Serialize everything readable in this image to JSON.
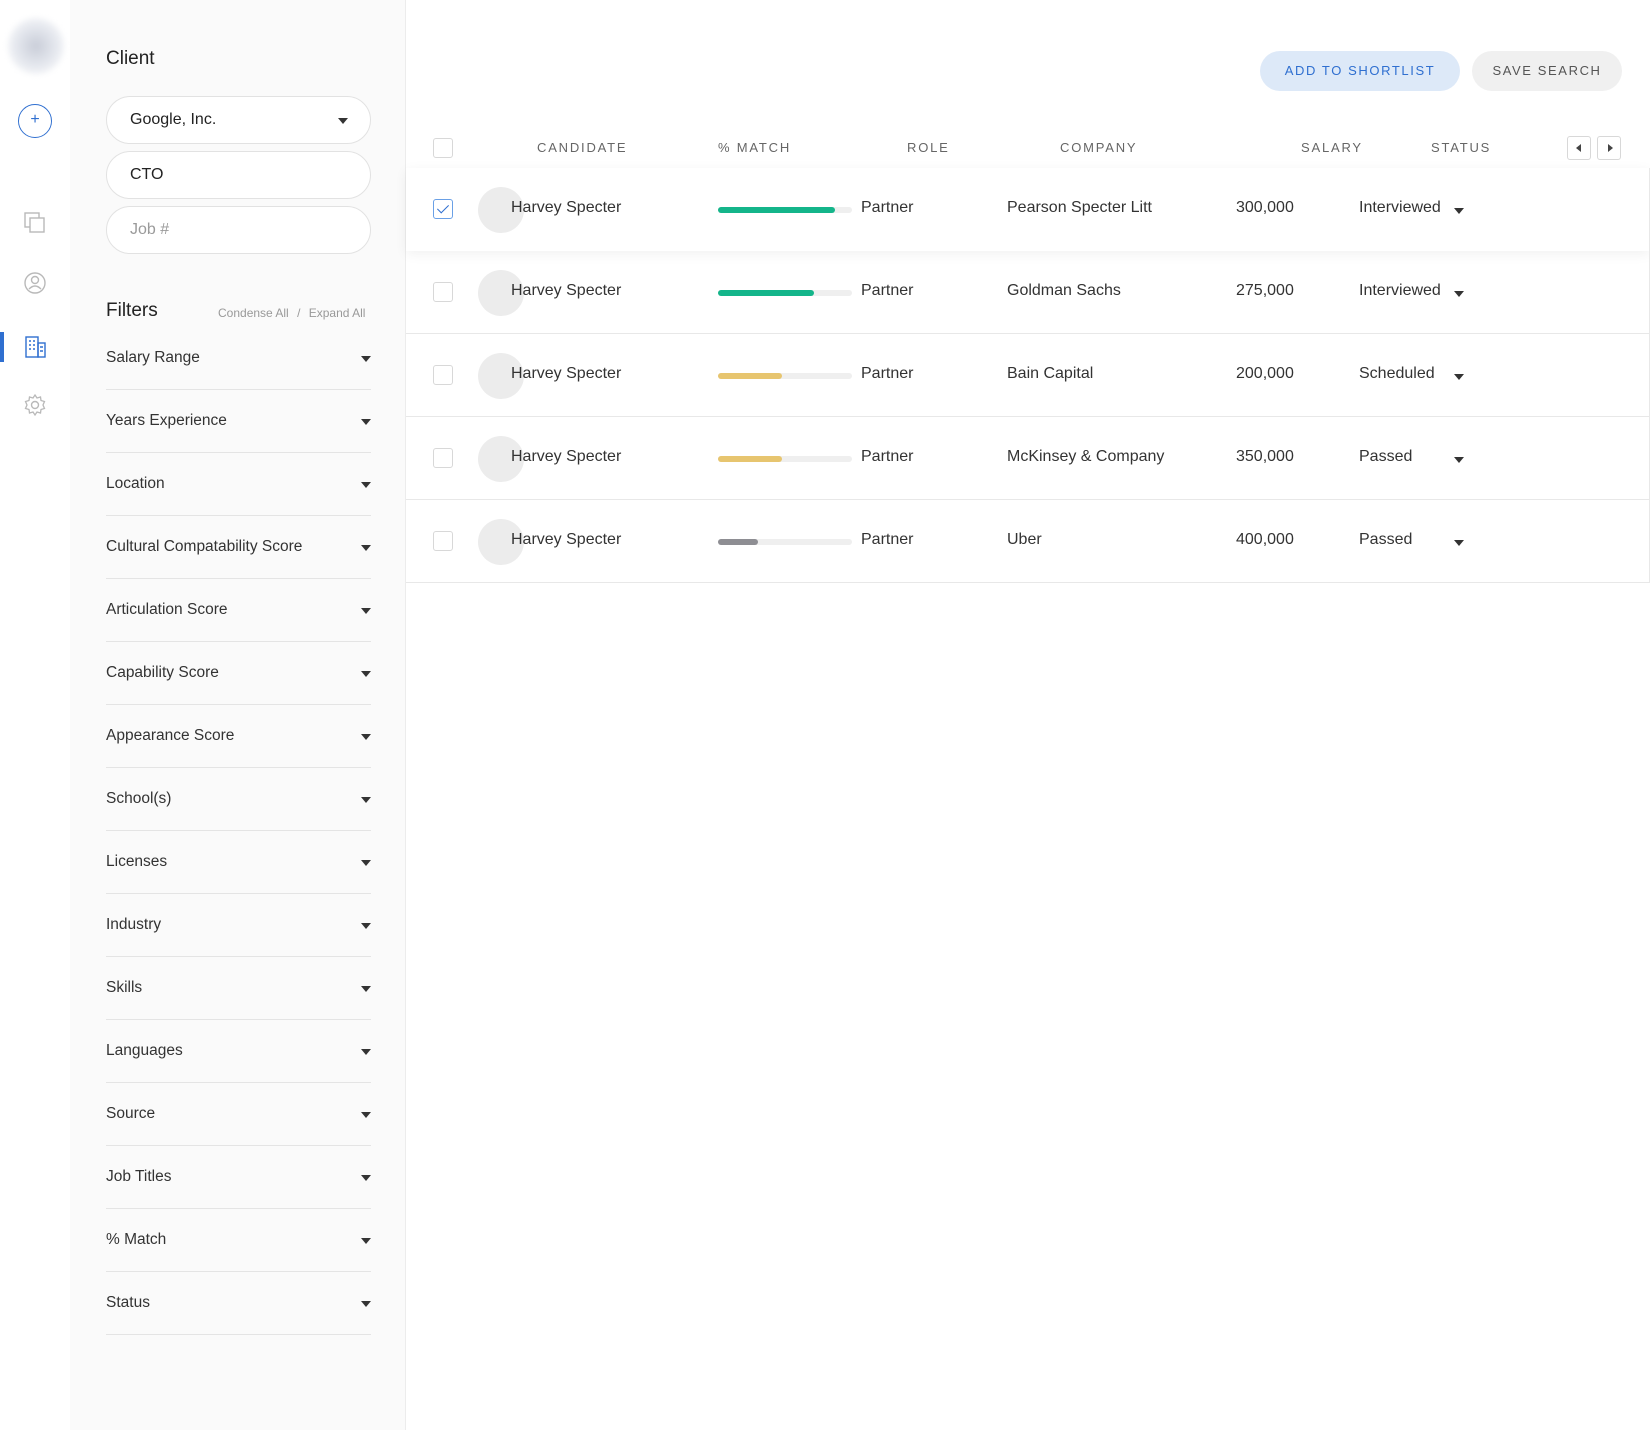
{
  "rail": {
    "add_label": "+",
    "icons": [
      "copy-icon",
      "user-circle-icon",
      "building-icon",
      "gear-icon"
    ],
    "active_color": "#2f6fd0"
  },
  "client": {
    "heading": "Client",
    "client_value": "Google, Inc.",
    "role_value": "CTO",
    "job_placeholder": "Job #"
  },
  "filters": {
    "heading": "Filters",
    "condense_label": "Condense All",
    "separator": "/",
    "expand_label": "Expand All",
    "items": [
      "Salary Range",
      "Years Experience",
      "Location",
      "Cultural Compatability Score",
      "Articulation Score",
      "Capability Score",
      "Appearance Score",
      "School(s)",
      "Licenses",
      "Industry",
      "Skills",
      "Languages",
      "Source",
      "Job Titles",
      "% Match",
      "Status"
    ]
  },
  "actions": {
    "shortlist_label": "ADD TO SHORTLIST",
    "save_label": "SAVE SEARCH"
  },
  "table": {
    "headers": {
      "candidate": "CANDIDATE",
      "match": "% MATCH",
      "role": "ROLE",
      "company": "COMPANY",
      "salary": "SALARY",
      "status": "STATUS"
    },
    "rows": [
      {
        "checked": true,
        "name": "Harvey Specter",
        "match": 0.87,
        "match_color": "#14b58a",
        "role": "Partner",
        "company": "Pearson Specter Litt",
        "salary": "300,000",
        "status": "Interviewed"
      },
      {
        "checked": false,
        "name": "Harvey Specter",
        "match": 0.72,
        "match_color": "#14b58a",
        "role": "Partner",
        "company": "Goldman Sachs",
        "salary": "275,000",
        "status": "Interviewed"
      },
      {
        "checked": false,
        "name": "Harvey Specter",
        "match": 0.48,
        "match_color": "#e7c56f",
        "role": "Partner",
        "company": "Bain Capital",
        "salary": "200,000",
        "status": "Scheduled"
      },
      {
        "checked": false,
        "name": "Harvey Specter",
        "match": 0.48,
        "match_color": "#e7c56f",
        "role": "Partner",
        "company": "McKinsey & Company",
        "salary": "350,000",
        "status": "Passed"
      },
      {
        "checked": false,
        "name": "Harvey Specter",
        "match": 0.3,
        "match_color": "#8e8e93",
        "role": "Partner",
        "company": "Uber",
        "salary": "400,000",
        "status": "Passed"
      }
    ]
  }
}
